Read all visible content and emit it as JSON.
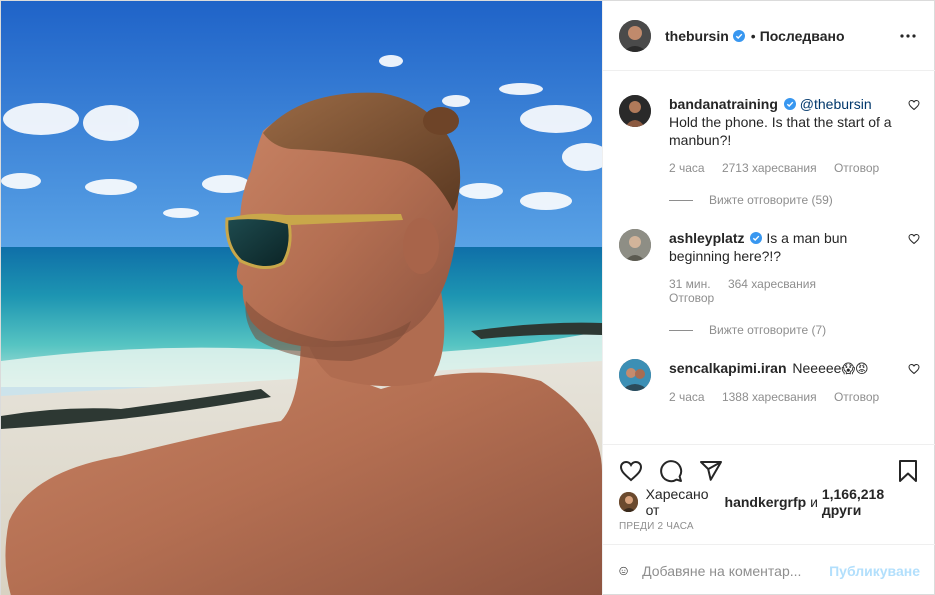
{
  "post": {
    "photo_alt": "Man with sunglasses on a beach",
    "author": {
      "username": "thebursin",
      "verified": true,
      "follow_state": "Последвано",
      "separator": "•"
    }
  },
  "comments": [
    {
      "username": "bandanatraining",
      "verified": true,
      "mention": "@thebursin",
      "text": "Hold the phone. Is that the start of a manbun?!",
      "time": "2 часа",
      "likes": "2713 харесвания",
      "reply_label": "Отговор",
      "view_replies": "Вижте отговорите (59)"
    },
    {
      "username": "ashleyplatz",
      "verified": true,
      "text": "Is a man bun beginning here?!?",
      "time": "31 мин.",
      "likes": "364 харесвания",
      "reply_label": "Отговор",
      "view_replies": "Вижте отговорите (7)"
    },
    {
      "username": "sencalkapimi.iran",
      "verified": false,
      "text": "Neeeee",
      "emojis": "😱😡",
      "time": "2 часа",
      "likes": "1388 харесвания",
      "reply_label": "Отговор"
    }
  ],
  "actions": {
    "icons": [
      "heart-icon",
      "comment-icon",
      "share-icon",
      "bookmark-icon"
    ],
    "liked_by_prefix": "Харесано от",
    "liked_by_user": "handkergrfp",
    "liked_by_conj": "и",
    "liked_by_count": "1,166,218 други",
    "timestamp": "ПРЕДИ 2 ЧАСА"
  },
  "add_comment": {
    "placeholder": "Добавяне на коментар...",
    "post_label": "Публикуване"
  },
  "colors": {
    "text": "#262626",
    "secondary": "#8e8e8e",
    "mention": "#00376b",
    "verified": "#3897f0",
    "post_disabled": "#b2dffc",
    "border": "#dbdbdb"
  }
}
